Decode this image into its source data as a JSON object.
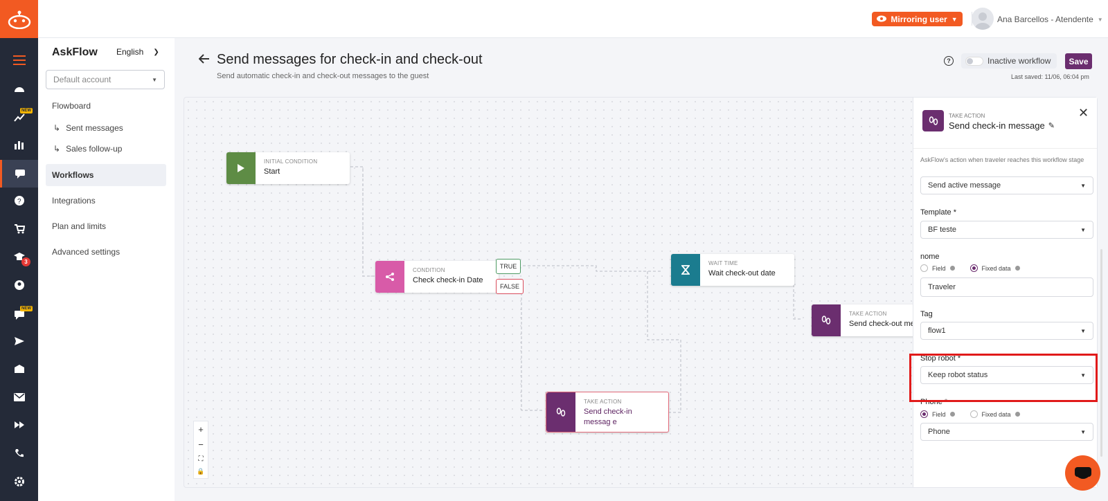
{
  "colors": {
    "brand": "#f25a22",
    "nav": "#242a38",
    "action": "#6b2e6f",
    "initial": "#5e8c45",
    "condition": "#d85ba8",
    "wait": "#1b7c8f",
    "highlight": "#e11a1a"
  },
  "rail": {
    "badge_new": "NEW",
    "badge_count": "3",
    "icons": [
      "menu-icon",
      "dashboard-icon",
      "trend-icon",
      "bar-chart-icon",
      "chat-icon",
      "help-icon",
      "cart-icon",
      "graduation-icon",
      "user-icon",
      "message-icon",
      "send-icon",
      "inbox-icon",
      "mail-icon",
      "forward-icon",
      "phone-icon",
      "settings-icon"
    ]
  },
  "topbar": {
    "mirroring_label": "Mirroring user",
    "user_name": "Ana Barcellos - Atendente"
  },
  "sidebar": {
    "title": "AskFlow",
    "language": "English",
    "account_placeholder": "Default account",
    "items": {
      "flowboard": "Flowboard",
      "sent_messages": "Sent messages",
      "sales_followup": "Sales follow-up",
      "workflows": "Workflows",
      "integrations": "Integrations",
      "plan": "Plan and limits",
      "advanced": "Advanced settings"
    }
  },
  "header": {
    "title": "Send messages for check-in and check-out",
    "subtitle": "Send automatic check-in and check-out messages to the guest",
    "help": "?",
    "toggle_label": "Inactive workflow",
    "save_label": "Save",
    "last_saved": "Last saved: 11/06, 06:04 pm"
  },
  "nodes": {
    "start": {
      "kind": "INITIAL CONDITION",
      "name": "Start"
    },
    "condition": {
      "kind": "CONDITION",
      "name": "Check check-in Date"
    },
    "wait": {
      "kind": "WAIT TIME",
      "name": "Wait check-out date"
    },
    "checkout": {
      "kind": "TAKE ACTION",
      "name": "Send check-out mess"
    },
    "checkin": {
      "kind": "TAKE ACTION",
      "name": "Send check-in messag e"
    }
  },
  "tags": {
    "true": "TRUE",
    "false": "FALSE"
  },
  "zoom": {
    "in": "+",
    "out": "−",
    "fit": "⛶",
    "lock": "🔒"
  },
  "panel": {
    "kind": "TAKE ACTION",
    "name": "Send check-in message",
    "description": "AskFlow's action when traveler reaches this workflow stage",
    "action_value": "Send active message",
    "template_label": "Template *",
    "template_value": "BF teste",
    "nome_label": "nome",
    "field_label": "Field",
    "fixed_label": "Fixed data",
    "nome_value": "Traveler",
    "tag_label": "Tag",
    "tag_value": "flow1",
    "stop_label": "Stop robot *",
    "stop_value": "Keep robot status",
    "phone_label": "Phone *",
    "phone_value": "Phone"
  }
}
